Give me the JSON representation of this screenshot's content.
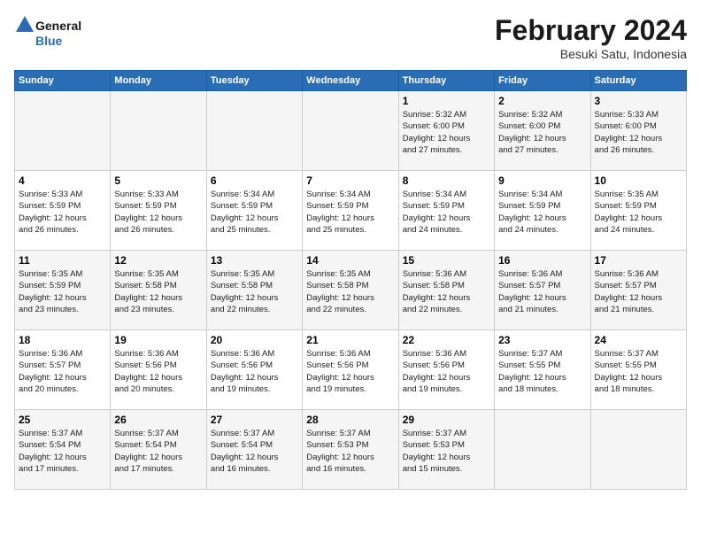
{
  "logo": {
    "text_general": "General",
    "text_blue": "Blue"
  },
  "title": "February 2024",
  "subtitle": "Besuki Satu, Indonesia",
  "days_header": [
    "Sunday",
    "Monday",
    "Tuesday",
    "Wednesday",
    "Thursday",
    "Friday",
    "Saturday"
  ],
  "weeks": [
    [
      {
        "day": "",
        "info": ""
      },
      {
        "day": "",
        "info": ""
      },
      {
        "day": "",
        "info": ""
      },
      {
        "day": "",
        "info": ""
      },
      {
        "day": "1",
        "info": "Sunrise: 5:32 AM\nSunset: 6:00 PM\nDaylight: 12 hours\nand 27 minutes."
      },
      {
        "day": "2",
        "info": "Sunrise: 5:32 AM\nSunset: 6:00 PM\nDaylight: 12 hours\nand 27 minutes."
      },
      {
        "day": "3",
        "info": "Sunrise: 5:33 AM\nSunset: 6:00 PM\nDaylight: 12 hours\nand 26 minutes."
      }
    ],
    [
      {
        "day": "4",
        "info": "Sunrise: 5:33 AM\nSunset: 5:59 PM\nDaylight: 12 hours\nand 26 minutes."
      },
      {
        "day": "5",
        "info": "Sunrise: 5:33 AM\nSunset: 5:59 PM\nDaylight: 12 hours\nand 26 minutes."
      },
      {
        "day": "6",
        "info": "Sunrise: 5:34 AM\nSunset: 5:59 PM\nDaylight: 12 hours\nand 25 minutes."
      },
      {
        "day": "7",
        "info": "Sunrise: 5:34 AM\nSunset: 5:59 PM\nDaylight: 12 hours\nand 25 minutes."
      },
      {
        "day": "8",
        "info": "Sunrise: 5:34 AM\nSunset: 5:59 PM\nDaylight: 12 hours\nand 24 minutes."
      },
      {
        "day": "9",
        "info": "Sunrise: 5:34 AM\nSunset: 5:59 PM\nDaylight: 12 hours\nand 24 minutes."
      },
      {
        "day": "10",
        "info": "Sunrise: 5:35 AM\nSunset: 5:59 PM\nDaylight: 12 hours\nand 24 minutes."
      }
    ],
    [
      {
        "day": "11",
        "info": "Sunrise: 5:35 AM\nSunset: 5:59 PM\nDaylight: 12 hours\nand 23 minutes."
      },
      {
        "day": "12",
        "info": "Sunrise: 5:35 AM\nSunset: 5:58 PM\nDaylight: 12 hours\nand 23 minutes."
      },
      {
        "day": "13",
        "info": "Sunrise: 5:35 AM\nSunset: 5:58 PM\nDaylight: 12 hours\nand 22 minutes."
      },
      {
        "day": "14",
        "info": "Sunrise: 5:35 AM\nSunset: 5:58 PM\nDaylight: 12 hours\nand 22 minutes."
      },
      {
        "day": "15",
        "info": "Sunrise: 5:36 AM\nSunset: 5:58 PM\nDaylight: 12 hours\nand 22 minutes."
      },
      {
        "day": "16",
        "info": "Sunrise: 5:36 AM\nSunset: 5:57 PM\nDaylight: 12 hours\nand 21 minutes."
      },
      {
        "day": "17",
        "info": "Sunrise: 5:36 AM\nSunset: 5:57 PM\nDaylight: 12 hours\nand 21 minutes."
      }
    ],
    [
      {
        "day": "18",
        "info": "Sunrise: 5:36 AM\nSunset: 5:57 PM\nDaylight: 12 hours\nand 20 minutes."
      },
      {
        "day": "19",
        "info": "Sunrise: 5:36 AM\nSunset: 5:56 PM\nDaylight: 12 hours\nand 20 minutes."
      },
      {
        "day": "20",
        "info": "Sunrise: 5:36 AM\nSunset: 5:56 PM\nDaylight: 12 hours\nand 19 minutes."
      },
      {
        "day": "21",
        "info": "Sunrise: 5:36 AM\nSunset: 5:56 PM\nDaylight: 12 hours\nand 19 minutes."
      },
      {
        "day": "22",
        "info": "Sunrise: 5:36 AM\nSunset: 5:56 PM\nDaylight: 12 hours\nand 19 minutes."
      },
      {
        "day": "23",
        "info": "Sunrise: 5:37 AM\nSunset: 5:55 PM\nDaylight: 12 hours\nand 18 minutes."
      },
      {
        "day": "24",
        "info": "Sunrise: 5:37 AM\nSunset: 5:55 PM\nDaylight: 12 hours\nand 18 minutes."
      }
    ],
    [
      {
        "day": "25",
        "info": "Sunrise: 5:37 AM\nSunset: 5:54 PM\nDaylight: 12 hours\nand 17 minutes."
      },
      {
        "day": "26",
        "info": "Sunrise: 5:37 AM\nSunset: 5:54 PM\nDaylight: 12 hours\nand 17 minutes."
      },
      {
        "day": "27",
        "info": "Sunrise: 5:37 AM\nSunset: 5:54 PM\nDaylight: 12 hours\nand 16 minutes."
      },
      {
        "day": "28",
        "info": "Sunrise: 5:37 AM\nSunset: 5:53 PM\nDaylight: 12 hours\nand 16 minutes."
      },
      {
        "day": "29",
        "info": "Sunrise: 5:37 AM\nSunset: 5:53 PM\nDaylight: 12 hours\nand 15 minutes."
      },
      {
        "day": "",
        "info": ""
      },
      {
        "day": "",
        "info": ""
      }
    ]
  ]
}
